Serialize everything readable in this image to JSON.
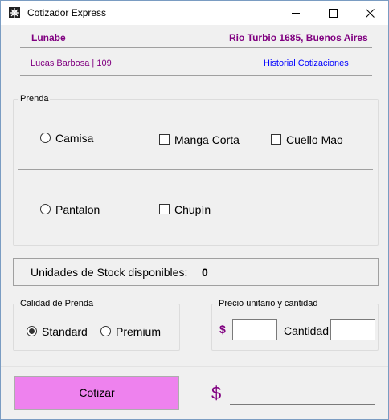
{
  "window": {
    "title": "Cotizador Express",
    "controls": {
      "minimize_icon": "minimize-icon",
      "maximize_icon": "maximize-icon",
      "close_icon": "close-icon"
    }
  },
  "header": {
    "store_name": "Lunabe",
    "address": "Rio Turbio 1685, Buenos Aires",
    "seller": "Lucas Barbosa | 109",
    "history_link": "Historial Cotizaciones"
  },
  "prenda": {
    "title": "Prenda",
    "camisa": {
      "label": "Camisa",
      "checked": false
    },
    "manga_corta": {
      "label": "Manga Corta",
      "checked": false
    },
    "cuello_mao": {
      "label": "Cuello Mao",
      "checked": false
    },
    "pantalon": {
      "label": "Pantalon",
      "checked": false
    },
    "chupin": {
      "label": "Chupín",
      "checked": false
    }
  },
  "stock": {
    "label": "Unidades de Stock disponibles:",
    "value": "0"
  },
  "calidad": {
    "title": "Calidad de Prenda",
    "standard": {
      "label": "Standard",
      "checked": true
    },
    "premium": {
      "label": "Premium",
      "checked": false
    }
  },
  "precio": {
    "title": "Precio unitario y cantidad",
    "currency_symbol": "$",
    "price_value": "",
    "quantity_label": "Cantidad",
    "quantity_value": ""
  },
  "footer": {
    "cotizar_label": "Cotizar",
    "currency_symbol": "$",
    "total_value": ""
  },
  "colors": {
    "accent": "#800080",
    "button_bg": "#ee82ee"
  }
}
